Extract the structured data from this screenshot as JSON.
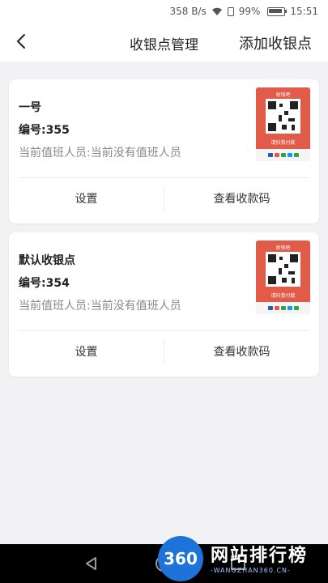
{
  "status_bar": {
    "speed": "358 B/s",
    "battery": "99%",
    "time": "15:51"
  },
  "header": {
    "title": "收银点管理",
    "add_label": "添加收银点"
  },
  "cards": [
    {
      "name": "一号",
      "code": "编号:355",
      "duty": "当前值班人员:当前没有值班人员",
      "settings_label": "设置",
      "qr_label": "查看收款码"
    },
    {
      "name": "默认收银点",
      "code": "编号:354",
      "duty": "当前值班人员:当前没有值班人员",
      "settings_label": "设置",
      "qr_label": "查看收款码"
    }
  ],
  "qr_thumb": {
    "top_text": "收钱吧",
    "caption": "请扫我付款",
    "accent": "#e25a48"
  },
  "watermark": {
    "logo_text": "360",
    "title": "网站排行榜",
    "subtitle": "-WANGZHAN360.CN-"
  },
  "icons": {
    "back": "chevron-left-icon",
    "wifi": "wifi-icon",
    "battery": "battery-icon",
    "nav_back": "triangle-back-icon",
    "nav_home": "circle-home-icon",
    "nav_recent": "square-recent-icon"
  }
}
